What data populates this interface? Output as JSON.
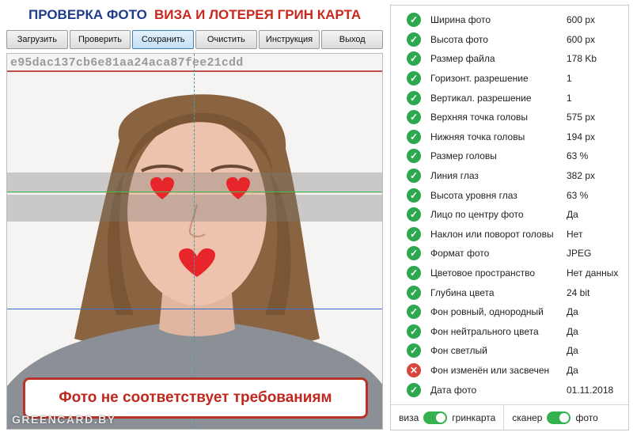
{
  "header": {
    "title_left": "ПРОВЕРКА ФОТО",
    "title_right": "ВИЗА И ЛОТЕРЕЯ ГРИН КАРТА"
  },
  "toolbar": {
    "buttons": [
      "Загрузить",
      "Проверить",
      "Сохранить",
      "Очистить",
      "Инструкция",
      "Выход"
    ],
    "active": "Сохранить"
  },
  "photo": {
    "hash": "e95dac137cb6e81aa24aca87fee21cdd",
    "warning": "Фото не соответствует требованиям",
    "watermark": "GREENCARD.BY"
  },
  "checks": [
    {
      "label": "Ширина фото",
      "value": "600 px",
      "status": "ok"
    },
    {
      "label": "Высота фото",
      "value": "600 px",
      "status": "ok"
    },
    {
      "label": "Размер файла",
      "value": "178 Kb",
      "status": "ok"
    },
    {
      "label": "Горизонт. разрешение",
      "value": "1",
      "status": "ok"
    },
    {
      "label": "Вертикал. разрешение",
      "value": "1",
      "status": "ok"
    },
    {
      "label": "Верхняя точка головы",
      "value": "575 px",
      "status": "ok"
    },
    {
      "label": "Нижняя точка головы",
      "value": "194 px",
      "status": "ok"
    },
    {
      "label": "Размер головы",
      "value": "63 %",
      "status": "ok"
    },
    {
      "label": "Линия глаз",
      "value": "382 px",
      "status": "ok"
    },
    {
      "label": "Высота уровня глаз",
      "value": "63 %",
      "status": "ok"
    },
    {
      "label": "Лицо по центру фото",
      "value": "Да",
      "status": "ok"
    },
    {
      "label": "Наклон или поворот головы",
      "value": "Нет",
      "status": "ok"
    },
    {
      "label": "Формат фото",
      "value": "JPEG",
      "status": "ok"
    },
    {
      "label": "Цветовое пространство",
      "value": "Нет данных",
      "status": "ok"
    },
    {
      "label": "Глубина цвета",
      "value": "24 bit",
      "status": "ok"
    },
    {
      "label": "Фон ровный, однородный",
      "value": "Да",
      "status": "ok"
    },
    {
      "label": "Фон нейтрального цвета",
      "value": "Да",
      "status": "ok"
    },
    {
      "label": "Фон светлый",
      "value": "Да",
      "status": "ok"
    },
    {
      "label": "Фон изменён или засвечен",
      "value": "Да",
      "status": "error"
    },
    {
      "label": "Дата фото",
      "value": "01.11.2018",
      "status": "ok"
    }
  ],
  "footer": {
    "switch_1": {
      "left": "виза",
      "right": "гринкарта",
      "state": "right"
    },
    "switch_2": {
      "left": "сканер",
      "right": "фото",
      "state": "right"
    }
  },
  "colors": {
    "title_blue": "#1f3d8f",
    "title_red": "#c8281e",
    "ok_green": "#2ea84f",
    "error_red": "#d9463b",
    "toggle_green": "#35b24f"
  }
}
